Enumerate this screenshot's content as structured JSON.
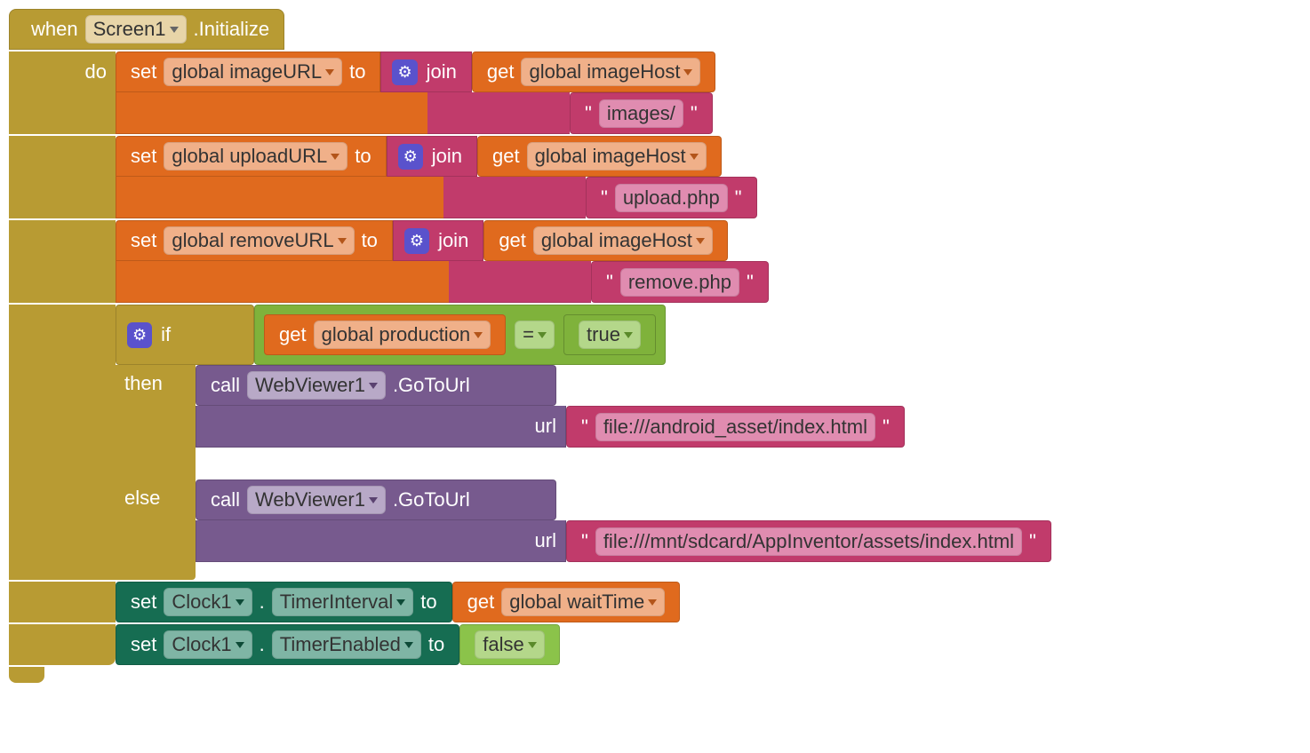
{
  "colors": {
    "event": "#b89b33",
    "set_global": "#e06a1e",
    "text": "#c13b6b",
    "logic": "#7fb23b",
    "procedure": "#775a8e",
    "property": "#166d52"
  },
  "header": {
    "when": "when",
    "component": "Screen1",
    "event": ".Initialize"
  },
  "labels": {
    "do": "do",
    "set": "set",
    "to": "to",
    "join": "join",
    "get": "get",
    "if": "if",
    "then": "then",
    "else": "else",
    "call": "call",
    "url": "url",
    "equals": "="
  },
  "vars": {
    "imageURL": "global imageURL",
    "uploadURL": "global uploadURL",
    "removeURL": "global removeURL",
    "imageHost": "global imageHost",
    "production": "global production",
    "waitTime": "global waitTime"
  },
  "values": {
    "images": "images/",
    "upload": "upload.php",
    "remove": "remove.php",
    "true": "true",
    "false": "false",
    "asset_url": "file:///android_asset/index.html",
    "sdcard_url": "file:///mnt/sdcard/AppInventor/assets/index.html"
  },
  "components": {
    "webviewer": "WebViewer1",
    "gotourl": ".GoToUrl",
    "clock": "Clock1",
    "timerInterval": "TimerInterval",
    "timerEnabled": "TimerEnabled"
  }
}
